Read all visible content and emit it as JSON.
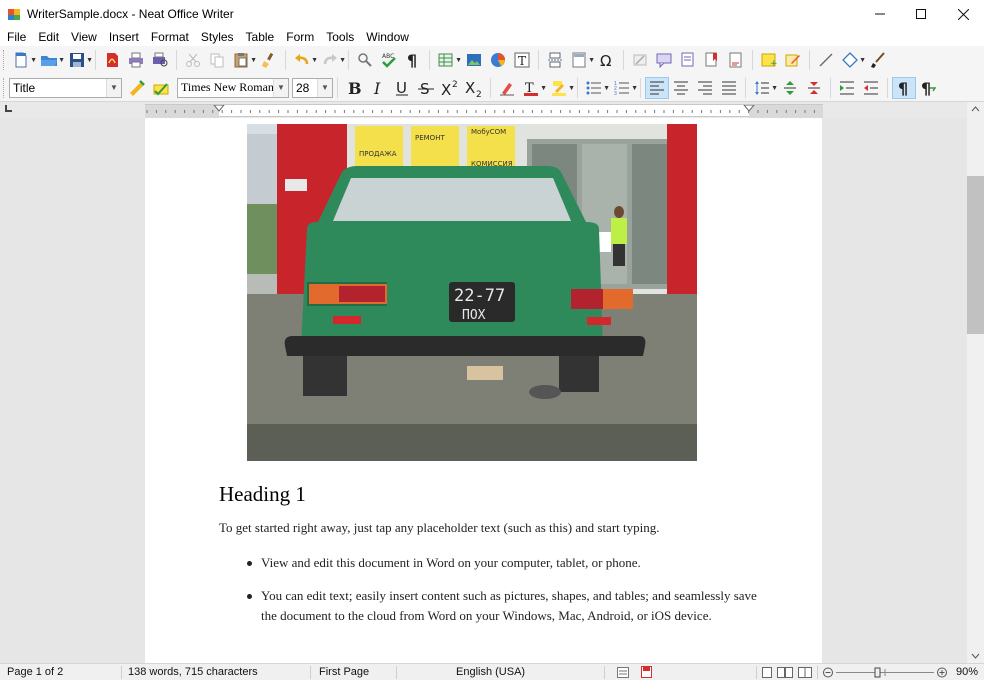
{
  "window": {
    "title": "WriterSample.docx - Neat Office Writer",
    "controls": [
      "minimize-icon",
      "maximize-icon",
      "close-icon"
    ]
  },
  "menu": [
    "File",
    "Edit",
    "View",
    "Insert",
    "Format",
    "Styles",
    "Table",
    "Form",
    "Tools",
    "Window"
  ],
  "format_bar": {
    "style_value": "Title",
    "font_value": "Times New Roman",
    "size_value": "28"
  },
  "document": {
    "heading": "Heading 1",
    "paragraph": "To get started right away, just tap any placeholder text (such as this) and start typing.",
    "bullets": [
      "View and edit this document in Word on your computer, tablet, or phone.",
      "You can edit text; easily insert content such as pictures, shapes, and tables; and seamlessly save the document to the cloud from Word on your Windows, Mac, Android, or iOS device."
    ],
    "photo": {
      "sign_1": "ПРОДАЖА",
      "sign_2": "РЕМОНТ",
      "sign_3": "МобуСОМ",
      "sign_4": "КОМИССИЯ",
      "plate_line_1": "22-77",
      "plate_line_2": "ПОХ"
    }
  },
  "status": {
    "page": "Page 1 of 2",
    "count": "138 words, 715 characters",
    "section": "First Page",
    "language": "English (USA)",
    "zoom": "90%"
  },
  "colors": {
    "car_green": "#2f8a5b",
    "wall_red": "#c8242c",
    "toolbar_bg": "#f5f5f5",
    "doc_bg": "#e6e6e6"
  }
}
